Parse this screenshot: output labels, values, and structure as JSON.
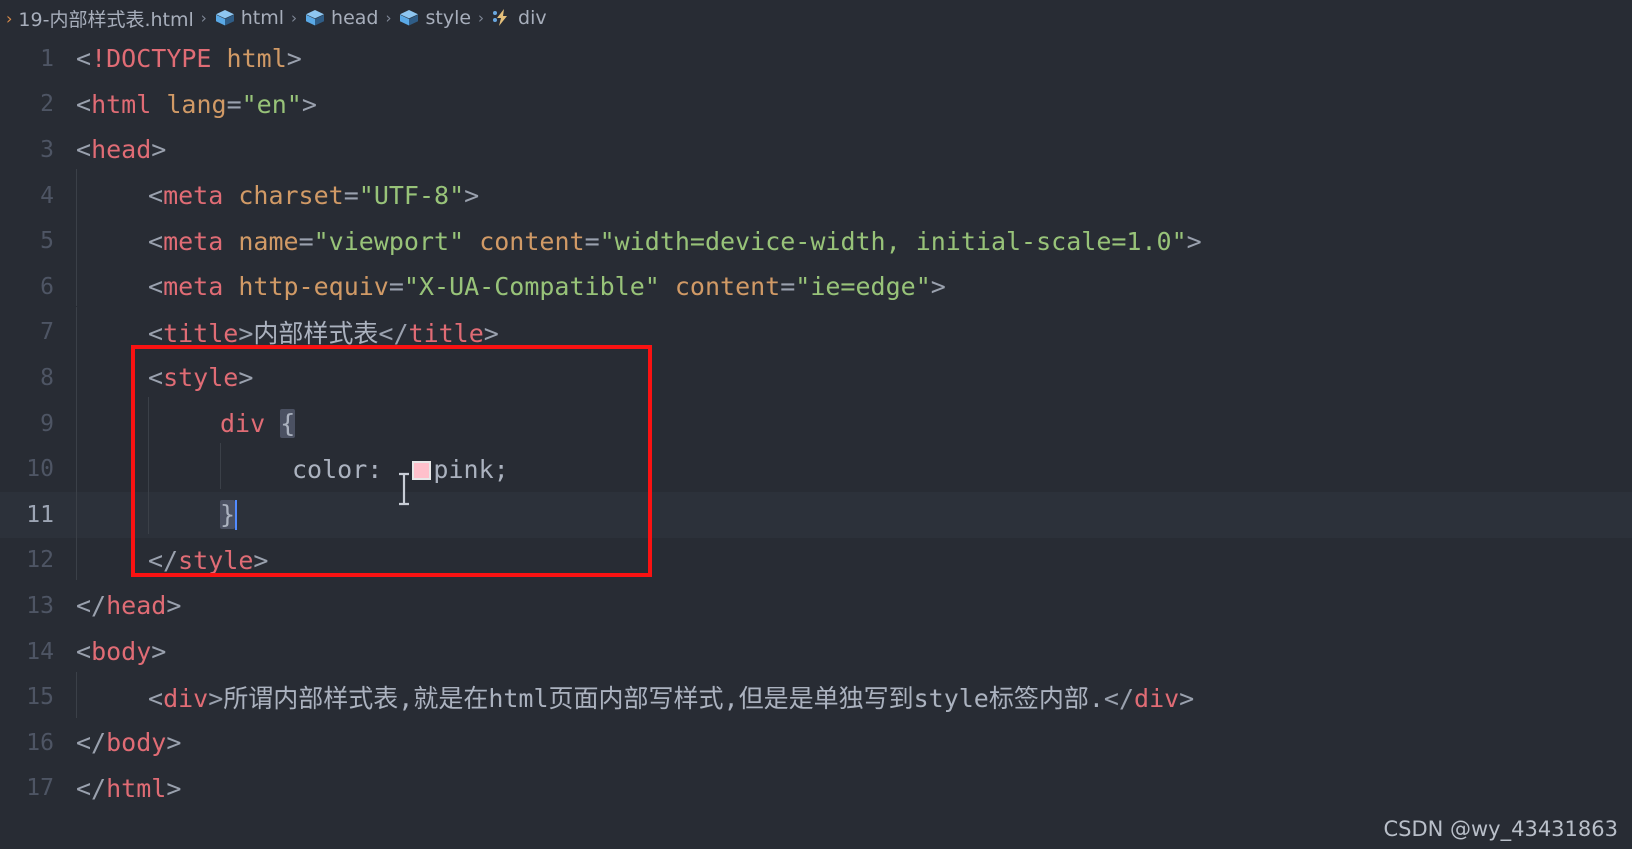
{
  "breadcrumb": {
    "separator": "›",
    "items": [
      {
        "label": "19-内部样式表.html",
        "icon": "none"
      },
      {
        "label": "html",
        "icon": "cube-icon"
      },
      {
        "label": "head",
        "icon": "cube-icon"
      },
      {
        "label": "style",
        "icon": "cube-icon"
      },
      {
        "label": "div",
        "icon": "symbol-field-icon"
      }
    ]
  },
  "editor": {
    "active_line": 11,
    "cursor_line": 11,
    "lines": [
      {
        "n": "1",
        "text": "<!DOCTYPE html>"
      },
      {
        "n": "2",
        "text": "<html lang=\"en\">"
      },
      {
        "n": "3",
        "text": "<head>"
      },
      {
        "n": "4",
        "text": "    <meta charset=\"UTF-8\">"
      },
      {
        "n": "5",
        "text": "    <meta name=\"viewport\" content=\"width=device-width, initial-scale=1.0\">"
      },
      {
        "n": "6",
        "text": "    <meta http-equiv=\"X-UA-Compatible\" content=\"ie=edge\">"
      },
      {
        "n": "7",
        "text": "    <title>内部样式表</title>"
      },
      {
        "n": "8",
        "text": "    <style>"
      },
      {
        "n": "9",
        "text": "        div {"
      },
      {
        "n": "10",
        "text": "            color:  pink;"
      },
      {
        "n": "11",
        "text": "        }"
      },
      {
        "n": "12",
        "text": "    </style>"
      },
      {
        "n": "13",
        "text": "</head>"
      },
      {
        "n": "14",
        "text": "<body>"
      },
      {
        "n": "15",
        "text": "    <div>所谓内部样式表,就是在html页面内部写样式,但是是单独写到style标签内部.</div>"
      },
      {
        "n": "16",
        "text": "</body>"
      },
      {
        "n": "17",
        "text": "</html>"
      }
    ],
    "tokens": {
      "doctype": "!DOCTYPE",
      "tag_html": "html",
      "tag_head": "head",
      "tag_meta": "meta",
      "tag_title": "title",
      "tag_style": "style",
      "tag_body": "body",
      "tag_div": "div",
      "attr_lang": "lang",
      "attr_charset": "charset",
      "attr_name": "name",
      "attr_content": "content",
      "attr_http_equiv": "http-equiv",
      "val_en": "\"en\"",
      "val_utf8": "\"UTF-8\"",
      "val_viewport": "\"viewport\"",
      "val_viewport_content": "\"width=device-width, initial-scale=1.0\"",
      "val_xua": "\"X-UA-Compatible\"",
      "val_ieedge": "\"ie=edge\"",
      "title_text": "内部样式表",
      "css_selector": "div",
      "css_open_brace": "{",
      "css_close_brace": "}",
      "css_property": "color:",
      "css_value": "pink;",
      "div_text": "所谓内部样式表,就是在html页面内部写样式,但是是单独写到style标签内部.",
      "lt": "<",
      "gt": ">",
      "lt_slash": "</"
    }
  },
  "annotation": {
    "shape": "rectangle",
    "color": "#fa1212"
  },
  "colors": {
    "editor_background": "#282c34",
    "active_line_background": "#2c313a",
    "tag": "#e06c75",
    "attribute": "#d19a66",
    "string": "#98c379",
    "text": "#abb2bf",
    "gutter": "#4e5564",
    "gutter_active": "#9da5b4",
    "caret": "#528bff",
    "swatch_pink": "#ffc0cb",
    "annotation_red": "#fa1212"
  },
  "watermark": {
    "text": "CSDN @wy_43431863"
  }
}
